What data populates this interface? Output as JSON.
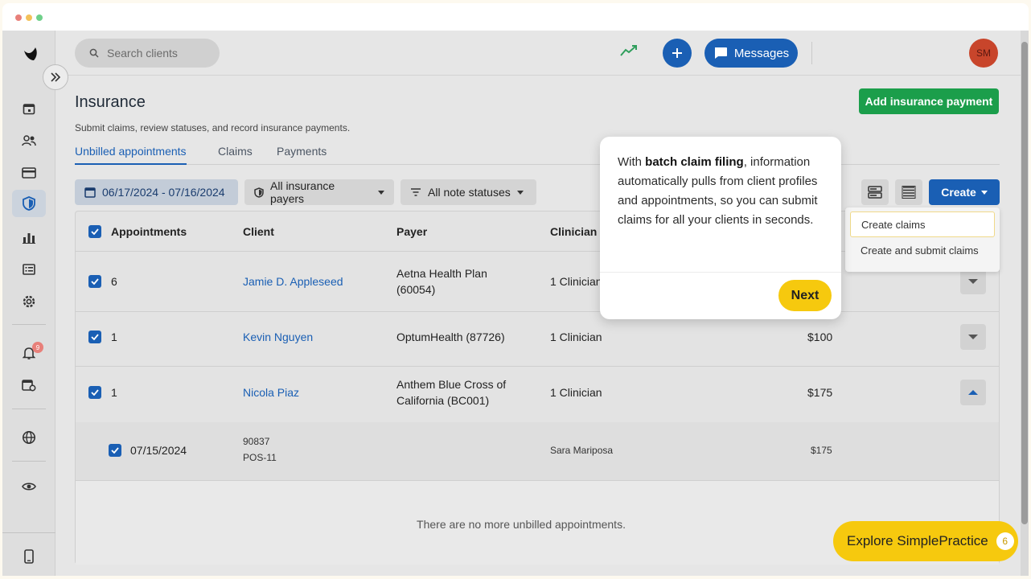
{
  "window_controls": {
    "close": "#e8807a",
    "minimize": "#f3c15a",
    "maximize": "#6fd08a"
  },
  "topbar": {
    "search_placeholder": "Search clients",
    "messages_label": "Messages",
    "avatar_initials": "SM"
  },
  "sidebar": {
    "notification_count": "9",
    "items": [
      "calendar-icon",
      "clients-icon",
      "billing-icon",
      "insurance-icon",
      "analytics-icon",
      "reports-icon",
      "settings-icon",
      "bell-icon",
      "calendar-settings-icon",
      "globe-icon",
      "eye-icon",
      "mobile-icon"
    ]
  },
  "page": {
    "title": "Insurance",
    "subtitle": "Submit claims, review statuses, and record insurance payments.",
    "add_payment_label": "Add insurance payment",
    "tabs": [
      {
        "label": "Unbilled appointments",
        "active": true
      },
      {
        "label": "Claims",
        "active": false
      },
      {
        "label": "Payments",
        "active": false
      }
    ],
    "filters": {
      "date_range": "06/17/2024 - 07/16/2024",
      "payers": "All insurance payers",
      "note_statuses": "All note statuses"
    },
    "create_label": "Create"
  },
  "table": {
    "headers": {
      "appointments": "Appointments",
      "client": "Client",
      "payer": "Payer",
      "clinician": "Clinician"
    },
    "rows": [
      {
        "count": "6",
        "client": "Jamie D. Appleseed",
        "payer_line1": "Aetna Health Plan",
        "payer_line2": "(60054)",
        "clinician": "1 Clinician",
        "amount": ""
      },
      {
        "count": "1",
        "client": "Kevin Nguyen",
        "payer_line1": "OptumHealth (87726)",
        "payer_line2": "",
        "clinician": "1 Clinician",
        "amount": "$100"
      },
      {
        "count": "1",
        "client": "Nicola Piaz",
        "payer_line1": "Anthem Blue Cross of",
        "payer_line2": "California (BC001)",
        "clinician": "1 Clinician",
        "amount": "$175"
      }
    ],
    "sub_row": {
      "date": "07/15/2024",
      "code": "90837",
      "pos": "POS-11",
      "clinician": "Sara Mariposa",
      "amount": "$175"
    },
    "empty_message": "There are no more unbilled appointments."
  },
  "dropdown": {
    "items": [
      "Create claims",
      "Create and submit claims"
    ]
  },
  "tour": {
    "text_before": "With ",
    "text_bold": "batch claim filing",
    "text_after": ", information automatically pulls from client profiles and appointments, so you can submit claims for all your clients in seconds.",
    "next_label": "Next"
  },
  "explore": {
    "label": "Explore SimplePractice",
    "count": "6"
  },
  "colors": {
    "primary": "#1a5fb4",
    "green": "#1b9e4b",
    "yellow": "#f6c90e"
  }
}
